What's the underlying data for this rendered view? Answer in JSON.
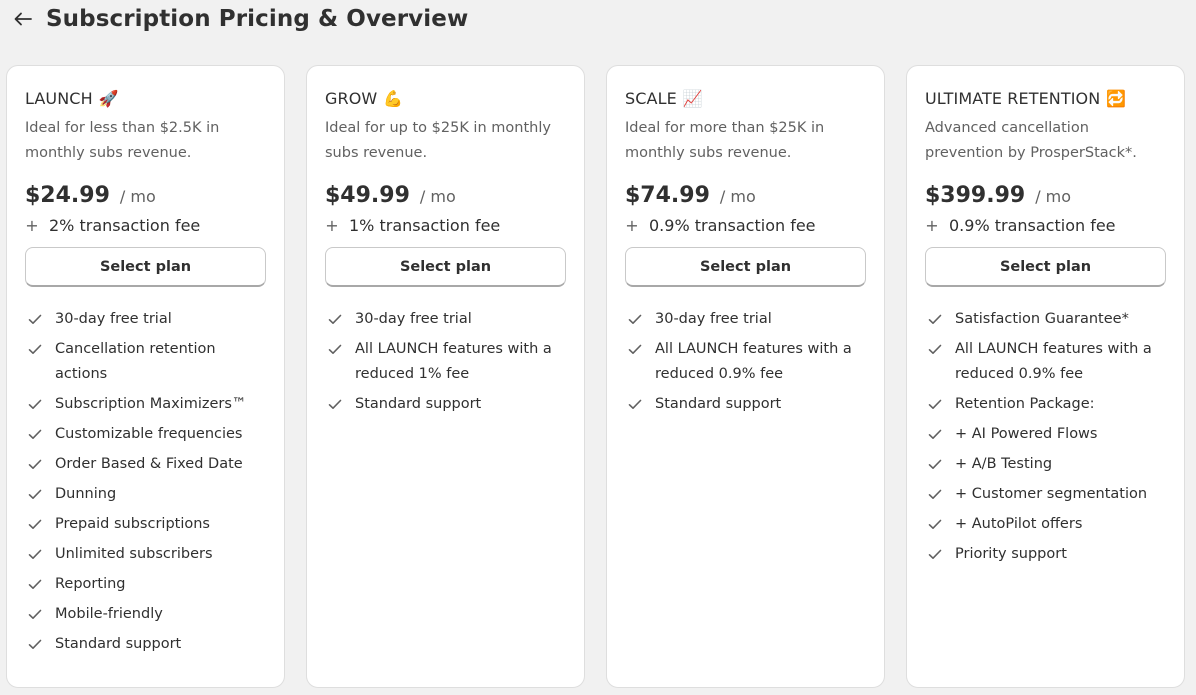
{
  "header": {
    "title": "Subscription Pricing & Overview",
    "back_icon": "arrow-left-icon"
  },
  "colors": {
    "background": "#f1f1f1",
    "card": "#ffffff",
    "text": "#303030",
    "muted": "#616161"
  },
  "plans": [
    {
      "name": "LAUNCH",
      "emoji": "🚀",
      "description": "Ideal for less than $2.5K in monthly subs revenue.",
      "price": "$24.99",
      "period": "/ mo",
      "plus": "+",
      "fee": "2% transaction fee",
      "button": "Select plan",
      "features": [
        "30-day free trial",
        "Cancellation retention actions",
        "Subscription Maximizers™",
        "Customizable frequencies",
        "Order Based & Fixed Date",
        "Dunning",
        "Prepaid subscriptions",
        "Unlimited subscribers",
        "Reporting",
        "Mobile-friendly",
        "Standard support"
      ]
    },
    {
      "name": "GROW",
      "emoji": "💪",
      "description": "Ideal for up to $25K in monthly subs revenue.",
      "price": "$49.99",
      "period": "/ mo",
      "plus": "+",
      "fee": "1% transaction fee",
      "button": "Select plan",
      "features": [
        "30-day free trial",
        "All LAUNCH features with a reduced 1% fee",
        "Standard support"
      ]
    },
    {
      "name": "SCALE",
      "emoji": "📈",
      "description": "Ideal for more than $25K in monthly subs revenue.",
      "price": "$74.99",
      "period": "/ mo",
      "plus": "+",
      "fee": "0.9% transaction fee",
      "button": "Select plan",
      "features": [
        "30-day free trial",
        "All LAUNCH features with a reduced 0.9% fee",
        "Standard support"
      ]
    },
    {
      "name": "ULTIMATE RETENTION",
      "emoji": "🔁",
      "description": "Advanced cancellation prevention by ProsperStack*.",
      "price": "$399.99",
      "period": "/ mo",
      "plus": "+",
      "fee": "0.9% transaction fee",
      "button": "Select plan",
      "features": [
        "Satisfaction Guarantee*",
        "All LAUNCH features with a reduced 0.9% fee",
        "Retention Package:",
        "+ AI Powered Flows",
        "+ A/B Testing",
        "+ Customer segmentation",
        "+ AutoPilot offers",
        "Priority support"
      ]
    }
  ]
}
